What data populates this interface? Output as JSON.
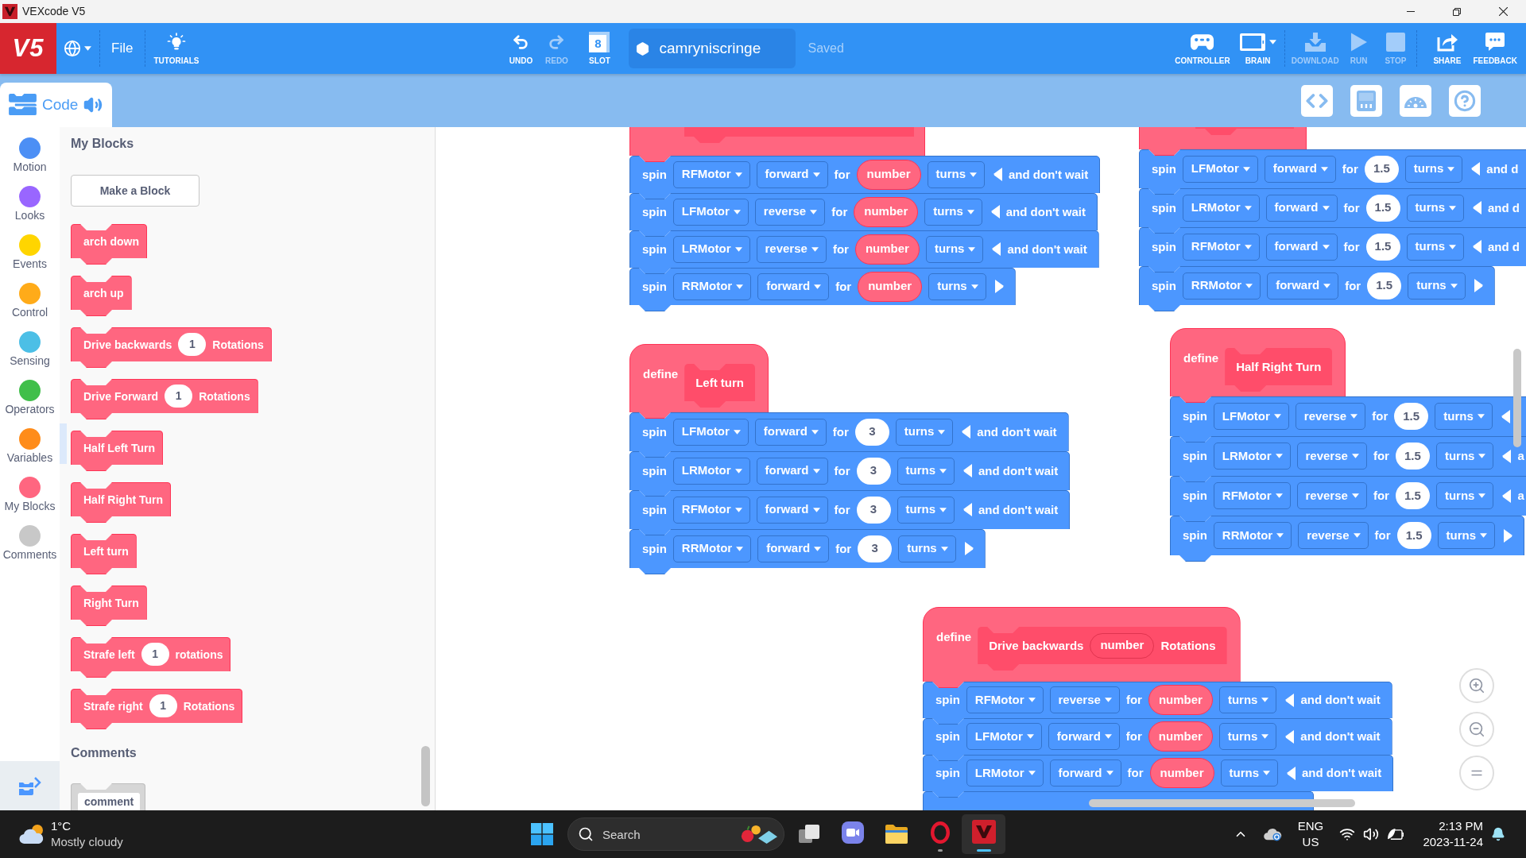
{
  "window": {
    "title": "VEXcode V5"
  },
  "toolbar": {
    "logo": "V5",
    "menu": [
      {
        "label": "File"
      }
    ],
    "left_tools": [
      {
        "kind": "tutorials",
        "label": "TUTORIALS",
        "disabled": false
      }
    ],
    "edit_tools": [
      {
        "kind": "undo",
        "label": "UNDO",
        "disabled": false
      },
      {
        "kind": "redo",
        "label": "REDO",
        "disabled": true
      },
      {
        "kind": "slot",
        "label": "SLOT",
        "slot": "8",
        "disabled": false
      }
    ],
    "project_name": "camryniscringe",
    "save_status": "Saved",
    "device_tools": [
      {
        "kind": "controller",
        "label": "CONTROLLER",
        "disabled": false
      },
      {
        "kind": "brain",
        "label": "BRAIN",
        "disabled": false
      }
    ],
    "run_tools": [
      {
        "kind": "download",
        "label": "DOWNLOAD",
        "disabled": true
      },
      {
        "kind": "run",
        "label": "RUN",
        "disabled": true
      },
      {
        "kind": "stop",
        "label": "STOP",
        "disabled": true
      }
    ],
    "share_tools": [
      {
        "kind": "share",
        "label": "SHARE",
        "disabled": false
      },
      {
        "kind": "feedback",
        "label": "FEEDBACK",
        "disabled": false
      }
    ]
  },
  "tabs": [
    {
      "label": "Code",
      "selected": true
    }
  ],
  "categories": [
    {
      "label": "Motion",
      "color": "#4c8ff5"
    },
    {
      "label": "Looks",
      "color": "#9966ff"
    },
    {
      "label": "Events",
      "color": "#ffd500"
    },
    {
      "label": "Control",
      "color": "#ffab19"
    },
    {
      "label": "Sensing",
      "color": "#4cbfe6"
    },
    {
      "label": "Operators",
      "color": "#40bf4a"
    },
    {
      "label": "Variables",
      "color": "#ff8c1a"
    },
    {
      "label": "My Blocks",
      "color": "#ff6680"
    },
    {
      "label": "Comments",
      "color": "#c8c8c8"
    }
  ],
  "palette": {
    "title": "My Blocks",
    "make_block": "Make a Block",
    "blocks": [
      {
        "parts": [
          {
            "kind": "label",
            "text": "arch down"
          }
        ]
      },
      {
        "parts": [
          {
            "kind": "label",
            "text": "arch up"
          }
        ]
      },
      {
        "parts": [
          {
            "kind": "label",
            "text": "Drive backwards"
          },
          {
            "kind": "number",
            "text": "1"
          },
          {
            "kind": "label",
            "text": "Rotations"
          }
        ]
      },
      {
        "parts": [
          {
            "kind": "label",
            "text": "Drive Forward"
          },
          {
            "kind": "number",
            "text": "1"
          },
          {
            "kind": "label",
            "text": "Rotations"
          }
        ]
      },
      {
        "parts": [
          {
            "kind": "label",
            "text": "Half Left Turn"
          }
        ]
      },
      {
        "parts": [
          {
            "kind": "label",
            "text": "Half Right Turn"
          }
        ]
      },
      {
        "parts": [
          {
            "kind": "label",
            "text": "Left turn"
          }
        ]
      },
      {
        "parts": [
          {
            "kind": "label",
            "text": "Right Turn"
          }
        ]
      },
      {
        "parts": [
          {
            "kind": "label",
            "text": "Strafe left"
          },
          {
            "kind": "number",
            "text": "1"
          },
          {
            "kind": "label",
            "text": "rotations"
          }
        ]
      },
      {
        "parts": [
          {
            "kind": "label",
            "text": "Strafe right"
          },
          {
            "kind": "number",
            "text": "1"
          },
          {
            "kind": "label",
            "text": "Rotations"
          }
        ]
      }
    ],
    "comments_title": "Comments",
    "comment_block": "comment"
  },
  "scripts": [
    {
      "hat": {
        "kind": "clipped"
      },
      "blocks": [
        {
          "parts": [
            {
              "kind": "label",
              "text": "spin"
            },
            {
              "kind": "dropdown",
              "text": "RFMotor"
            },
            {
              "kind": "dropdown",
              "text": "forward"
            },
            {
              "kind": "label",
              "text": "for"
            },
            {
              "kind": "reporter",
              "text": "number"
            },
            {
              "kind": "dropdown",
              "text": "turns"
            },
            {
              "kind": "toggle",
              "expanded": true
            },
            {
              "kind": "label",
              "text": "and don't wait"
            }
          ]
        },
        {
          "parts": [
            {
              "kind": "label",
              "text": "spin"
            },
            {
              "kind": "dropdown",
              "text": "LFMotor"
            },
            {
              "kind": "dropdown",
              "text": "reverse"
            },
            {
              "kind": "label",
              "text": "for"
            },
            {
              "kind": "reporter",
              "text": "number"
            },
            {
              "kind": "dropdown",
              "text": "turns"
            },
            {
              "kind": "toggle",
              "expanded": true
            },
            {
              "kind": "label",
              "text": "and don't wait"
            }
          ]
        },
        {
          "parts": [
            {
              "kind": "label",
              "text": "spin"
            },
            {
              "kind": "dropdown",
              "text": "LRMotor"
            },
            {
              "kind": "dropdown",
              "text": "reverse"
            },
            {
              "kind": "label",
              "text": "for"
            },
            {
              "kind": "reporter",
              "text": "number"
            },
            {
              "kind": "dropdown",
              "text": "turns"
            },
            {
              "kind": "toggle",
              "expanded": true
            },
            {
              "kind": "label",
              "text": "and don't wait"
            }
          ]
        },
        {
          "parts": [
            {
              "kind": "label",
              "text": "spin"
            },
            {
              "kind": "dropdown",
              "text": "RRMotor"
            },
            {
              "kind": "dropdown",
              "text": "forward"
            },
            {
              "kind": "label",
              "text": "for"
            },
            {
              "kind": "reporter",
              "text": "number"
            },
            {
              "kind": "dropdown",
              "text": "turns"
            },
            {
              "kind": "toggle",
              "expanded": false
            }
          ]
        }
      ]
    },
    {
      "hat": {
        "kind": "clipped"
      },
      "blocks": [
        {
          "parts": [
            {
              "kind": "label",
              "text": "spin"
            },
            {
              "kind": "dropdown",
              "text": "LFMotor"
            },
            {
              "kind": "dropdown",
              "text": "forward"
            },
            {
              "kind": "label",
              "text": "for"
            },
            {
              "kind": "number",
              "text": "1.5"
            },
            {
              "kind": "dropdown",
              "text": "turns"
            },
            {
              "kind": "toggle",
              "expanded": true
            },
            {
              "kind": "label",
              "text": "and d"
            }
          ]
        },
        {
          "parts": [
            {
              "kind": "label",
              "text": "spin"
            },
            {
              "kind": "dropdown",
              "text": "LRMotor"
            },
            {
              "kind": "dropdown",
              "text": "forward"
            },
            {
              "kind": "label",
              "text": "for"
            },
            {
              "kind": "number",
              "text": "1.5"
            },
            {
              "kind": "dropdown",
              "text": "turns"
            },
            {
              "kind": "toggle",
              "expanded": true
            },
            {
              "kind": "label",
              "text": "and d"
            }
          ]
        },
        {
          "parts": [
            {
              "kind": "label",
              "text": "spin"
            },
            {
              "kind": "dropdown",
              "text": "RFMotor"
            },
            {
              "kind": "dropdown",
              "text": "forward"
            },
            {
              "kind": "label",
              "text": "for"
            },
            {
              "kind": "number",
              "text": "1.5"
            },
            {
              "kind": "dropdown",
              "text": "turns"
            },
            {
              "kind": "toggle",
              "expanded": true
            },
            {
              "kind": "label",
              "text": "and d"
            }
          ]
        },
        {
          "parts": [
            {
              "kind": "label",
              "text": "spin"
            },
            {
              "kind": "dropdown",
              "text": "RRMotor"
            },
            {
              "kind": "dropdown",
              "text": "forward"
            },
            {
              "kind": "label",
              "text": "for"
            },
            {
              "kind": "number",
              "text": "1.5"
            },
            {
              "kind": "dropdown",
              "text": "turns"
            },
            {
              "kind": "toggle",
              "expanded": false
            }
          ]
        }
      ]
    },
    {
      "hat": {
        "kind": "define",
        "label": "define",
        "parts": [
          {
            "kind": "label",
            "text": "Left turn"
          }
        ]
      },
      "blocks": [
        {
          "parts": [
            {
              "kind": "label",
              "text": "spin"
            },
            {
              "kind": "dropdown",
              "text": "LFMotor"
            },
            {
              "kind": "dropdown",
              "text": "forward"
            },
            {
              "kind": "label",
              "text": "for"
            },
            {
              "kind": "number",
              "text": "3"
            },
            {
              "kind": "dropdown",
              "text": "turns"
            },
            {
              "kind": "toggle",
              "expanded": true
            },
            {
              "kind": "label",
              "text": "and don't wait"
            }
          ]
        },
        {
          "parts": [
            {
              "kind": "label",
              "text": "spin"
            },
            {
              "kind": "dropdown",
              "text": "LRMotor"
            },
            {
              "kind": "dropdown",
              "text": "forward"
            },
            {
              "kind": "label",
              "text": "for"
            },
            {
              "kind": "number",
              "text": "3"
            },
            {
              "kind": "dropdown",
              "text": "turns"
            },
            {
              "kind": "toggle",
              "expanded": true
            },
            {
              "kind": "label",
              "text": "and don't wait"
            }
          ]
        },
        {
          "parts": [
            {
              "kind": "label",
              "text": "spin"
            },
            {
              "kind": "dropdown",
              "text": "RFMotor"
            },
            {
              "kind": "dropdown",
              "text": "forward"
            },
            {
              "kind": "label",
              "text": "for"
            },
            {
              "kind": "number",
              "text": "3"
            },
            {
              "kind": "dropdown",
              "text": "turns"
            },
            {
              "kind": "toggle",
              "expanded": true
            },
            {
              "kind": "label",
              "text": "and don't wait"
            }
          ]
        },
        {
          "parts": [
            {
              "kind": "label",
              "text": "spin"
            },
            {
              "kind": "dropdown",
              "text": "RRMotor"
            },
            {
              "kind": "dropdown",
              "text": "forward"
            },
            {
              "kind": "label",
              "text": "for"
            },
            {
              "kind": "number",
              "text": "3"
            },
            {
              "kind": "dropdown",
              "text": "turns"
            },
            {
              "kind": "toggle",
              "expanded": false
            }
          ]
        }
      ]
    },
    {
      "hat": {
        "kind": "define",
        "label": "define",
        "parts": [
          {
            "kind": "label",
            "text": "Half Right Turn"
          }
        ]
      },
      "blocks": [
        {
          "parts": [
            {
              "kind": "label",
              "text": "spin"
            },
            {
              "kind": "dropdown",
              "text": "LFMotor"
            },
            {
              "kind": "dropdown",
              "text": "reverse"
            },
            {
              "kind": "label",
              "text": "for"
            },
            {
              "kind": "number",
              "text": "1.5"
            },
            {
              "kind": "dropdown",
              "text": "turns"
            },
            {
              "kind": "toggle",
              "expanded": true
            }
          ]
        },
        {
          "parts": [
            {
              "kind": "label",
              "text": "spin"
            },
            {
              "kind": "dropdown",
              "text": "LRMotor"
            },
            {
              "kind": "dropdown",
              "text": "reverse"
            },
            {
              "kind": "label",
              "text": "for"
            },
            {
              "kind": "number",
              "text": "1.5"
            },
            {
              "kind": "dropdown",
              "text": "turns"
            },
            {
              "kind": "toggle",
              "expanded": true
            },
            {
              "kind": "label",
              "text": "a"
            }
          ]
        },
        {
          "parts": [
            {
              "kind": "label",
              "text": "spin"
            },
            {
              "kind": "dropdown",
              "text": "RFMotor"
            },
            {
              "kind": "dropdown",
              "text": "reverse"
            },
            {
              "kind": "label",
              "text": "for"
            },
            {
              "kind": "number",
              "text": "1.5"
            },
            {
              "kind": "dropdown",
              "text": "turns"
            },
            {
              "kind": "toggle",
              "expanded": true
            },
            {
              "kind": "label",
              "text": "a"
            }
          ]
        },
        {
          "parts": [
            {
              "kind": "label",
              "text": "spin"
            },
            {
              "kind": "dropdown",
              "text": "RRMotor"
            },
            {
              "kind": "dropdown",
              "text": "reverse"
            },
            {
              "kind": "label",
              "text": "for"
            },
            {
              "kind": "number",
              "text": "1.5"
            },
            {
              "kind": "dropdown",
              "text": "turns"
            },
            {
              "kind": "toggle",
              "expanded": false
            }
          ]
        }
      ]
    },
    {
      "hat": {
        "kind": "define",
        "label": "define",
        "parts": [
          {
            "kind": "label",
            "text": "Drive backwards"
          },
          {
            "kind": "parameter",
            "text": "number"
          },
          {
            "kind": "label",
            "text": "Rotations"
          }
        ]
      },
      "more_below": true,
      "blocks": [
        {
          "parts": [
            {
              "kind": "label",
              "text": "spin"
            },
            {
              "kind": "dropdown",
              "text": "RFMotor"
            },
            {
              "kind": "dropdown",
              "text": "reverse"
            },
            {
              "kind": "label",
              "text": "for"
            },
            {
              "kind": "reporter",
              "text": "number"
            },
            {
              "kind": "dropdown",
              "text": "turns"
            },
            {
              "kind": "toggle",
              "expanded": true
            },
            {
              "kind": "label",
              "text": "and don't wait"
            }
          ]
        },
        {
          "parts": [
            {
              "kind": "label",
              "text": "spin"
            },
            {
              "kind": "dropdown",
              "text": "LFMotor"
            },
            {
              "kind": "dropdown",
              "text": "forward"
            },
            {
              "kind": "label",
              "text": "for"
            },
            {
              "kind": "reporter",
              "text": "number"
            },
            {
              "kind": "dropdown",
              "text": "turns"
            },
            {
              "kind": "toggle",
              "expanded": true
            },
            {
              "kind": "label",
              "text": "and don't wait"
            }
          ]
        },
        {
          "parts": [
            {
              "kind": "label",
              "text": "spin"
            },
            {
              "kind": "dropdown",
              "text": "LRMotor"
            },
            {
              "kind": "dropdown",
              "text": "forward"
            },
            {
              "kind": "label",
              "text": "for"
            },
            {
              "kind": "reporter",
              "text": "number"
            },
            {
              "kind": "dropdown",
              "text": "turns"
            },
            {
              "kind": "toggle",
              "expanded": true
            },
            {
              "kind": "label",
              "text": "and don't wait"
            }
          ]
        }
      ]
    }
  ],
  "taskbar": {
    "weather": {
      "temperature": "1°C",
      "condition": "Mostly cloudy"
    },
    "search": {
      "placeholder": "Search"
    },
    "apps": [
      {
        "kind": "chat",
        "running": false,
        "selected": false
      },
      {
        "kind": "files",
        "running": false,
        "selected": false
      },
      {
        "kind": "browser",
        "running": true,
        "selected": false
      },
      {
        "kind": "vexcode",
        "running": true,
        "selected": true
      }
    ],
    "language": {
      "code": "ENG",
      "region": "US"
    },
    "clock": {
      "time": "2:13 PM",
      "date": "2023-11-24"
    }
  }
}
